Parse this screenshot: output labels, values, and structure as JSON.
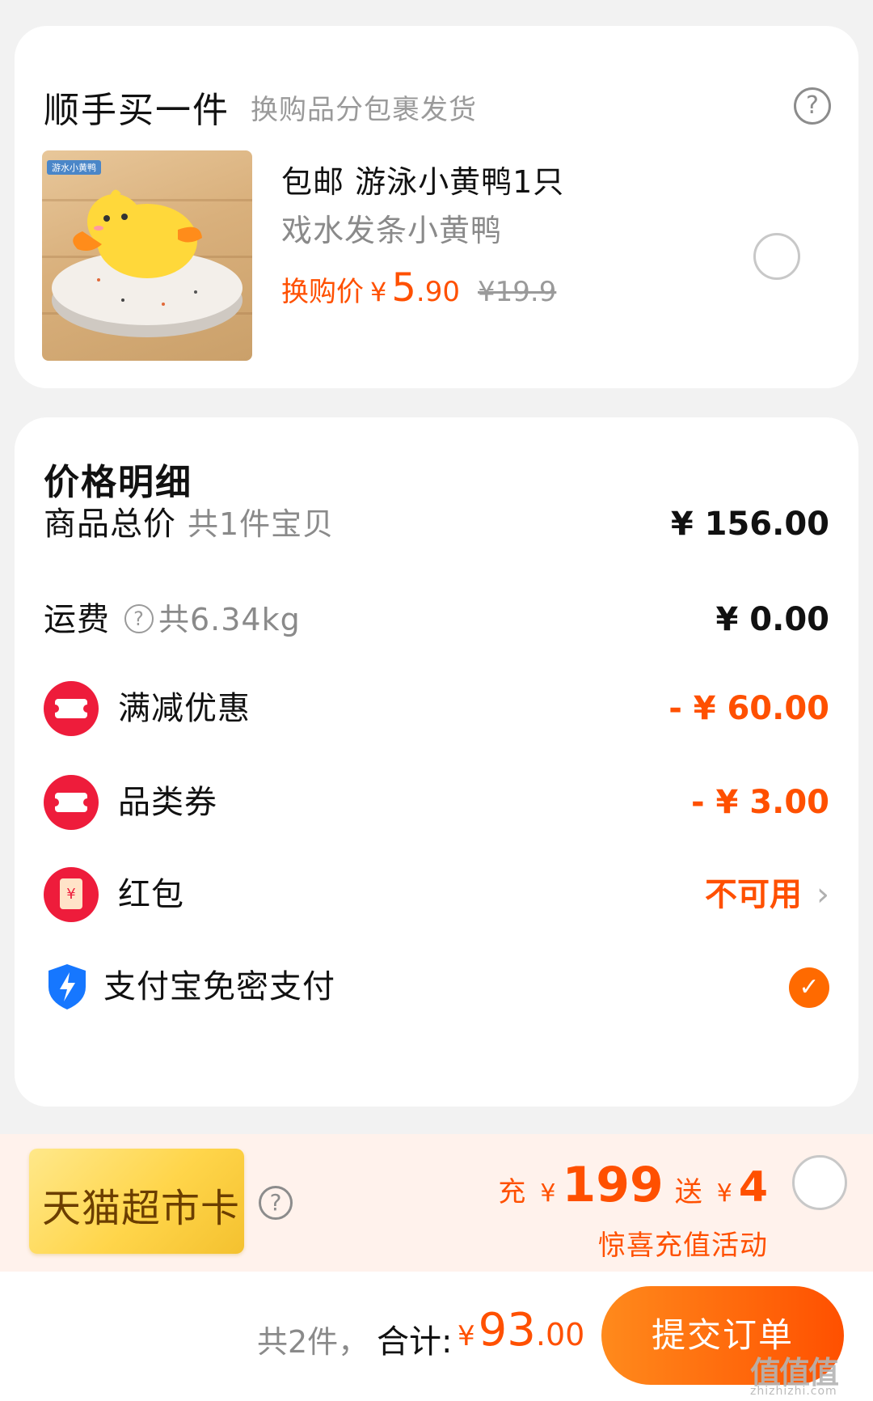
{
  "addon": {
    "title": "顺手买一件",
    "subtitle": "换购品分包裹发货",
    "help_icon": "question-circle-icon",
    "product": {
      "image_tag": "游水小黄鸭",
      "name": "包邮 游泳小黄鸭1只",
      "description": "戏水发条小黄鸭",
      "price_label": "换购价",
      "currency": "¥",
      "price_int": "5",
      "price_dec": ".90",
      "original_price": "¥19.9",
      "selected": false
    }
  },
  "detail": {
    "title": "价格明细",
    "goods_total": {
      "label": "商品总价",
      "sub": "共1件宝贝",
      "value": "¥ 156.00"
    },
    "shipping": {
      "label": "运费",
      "sub": "共6.34kg",
      "value": "¥ 0.00"
    },
    "full_discount": {
      "label": "满减优惠",
      "value": "- ¥ 60.00",
      "icon": "ticket-icon"
    },
    "category_coupon": {
      "label": "品类券",
      "value": "- ¥ 3.00",
      "icon": "ticket-icon"
    },
    "red_packet": {
      "label": "红包",
      "value": "不可用",
      "icon": "red-envelope-icon",
      "icon_text": "¥"
    },
    "alipay": {
      "label": "支付宝免密支付",
      "icon": "shield-lightning-icon",
      "checked": true
    }
  },
  "tmall": {
    "card_label": "天猫超市卡",
    "recharge_prefix": "充",
    "recharge_currency": "¥",
    "recharge_amount": "199",
    "bonus_prefix": "送",
    "bonus_currency": "¥",
    "bonus_amount": "4",
    "activity": "惊喜充值活动",
    "selected": false
  },
  "footer": {
    "count": "共2件，",
    "total_label": "合计:",
    "currency": "¥",
    "total_int": "93",
    "total_dec": ".00",
    "submit_label": "提交订单",
    "watermark": "值值值",
    "watermark_sub": "zhizhizhi.com"
  },
  "colors": {
    "accent": "#ff5000",
    "coupon_red": "#ee1c3b",
    "check_orange": "#ff6a00",
    "alipay_blue": "#1677ff"
  }
}
